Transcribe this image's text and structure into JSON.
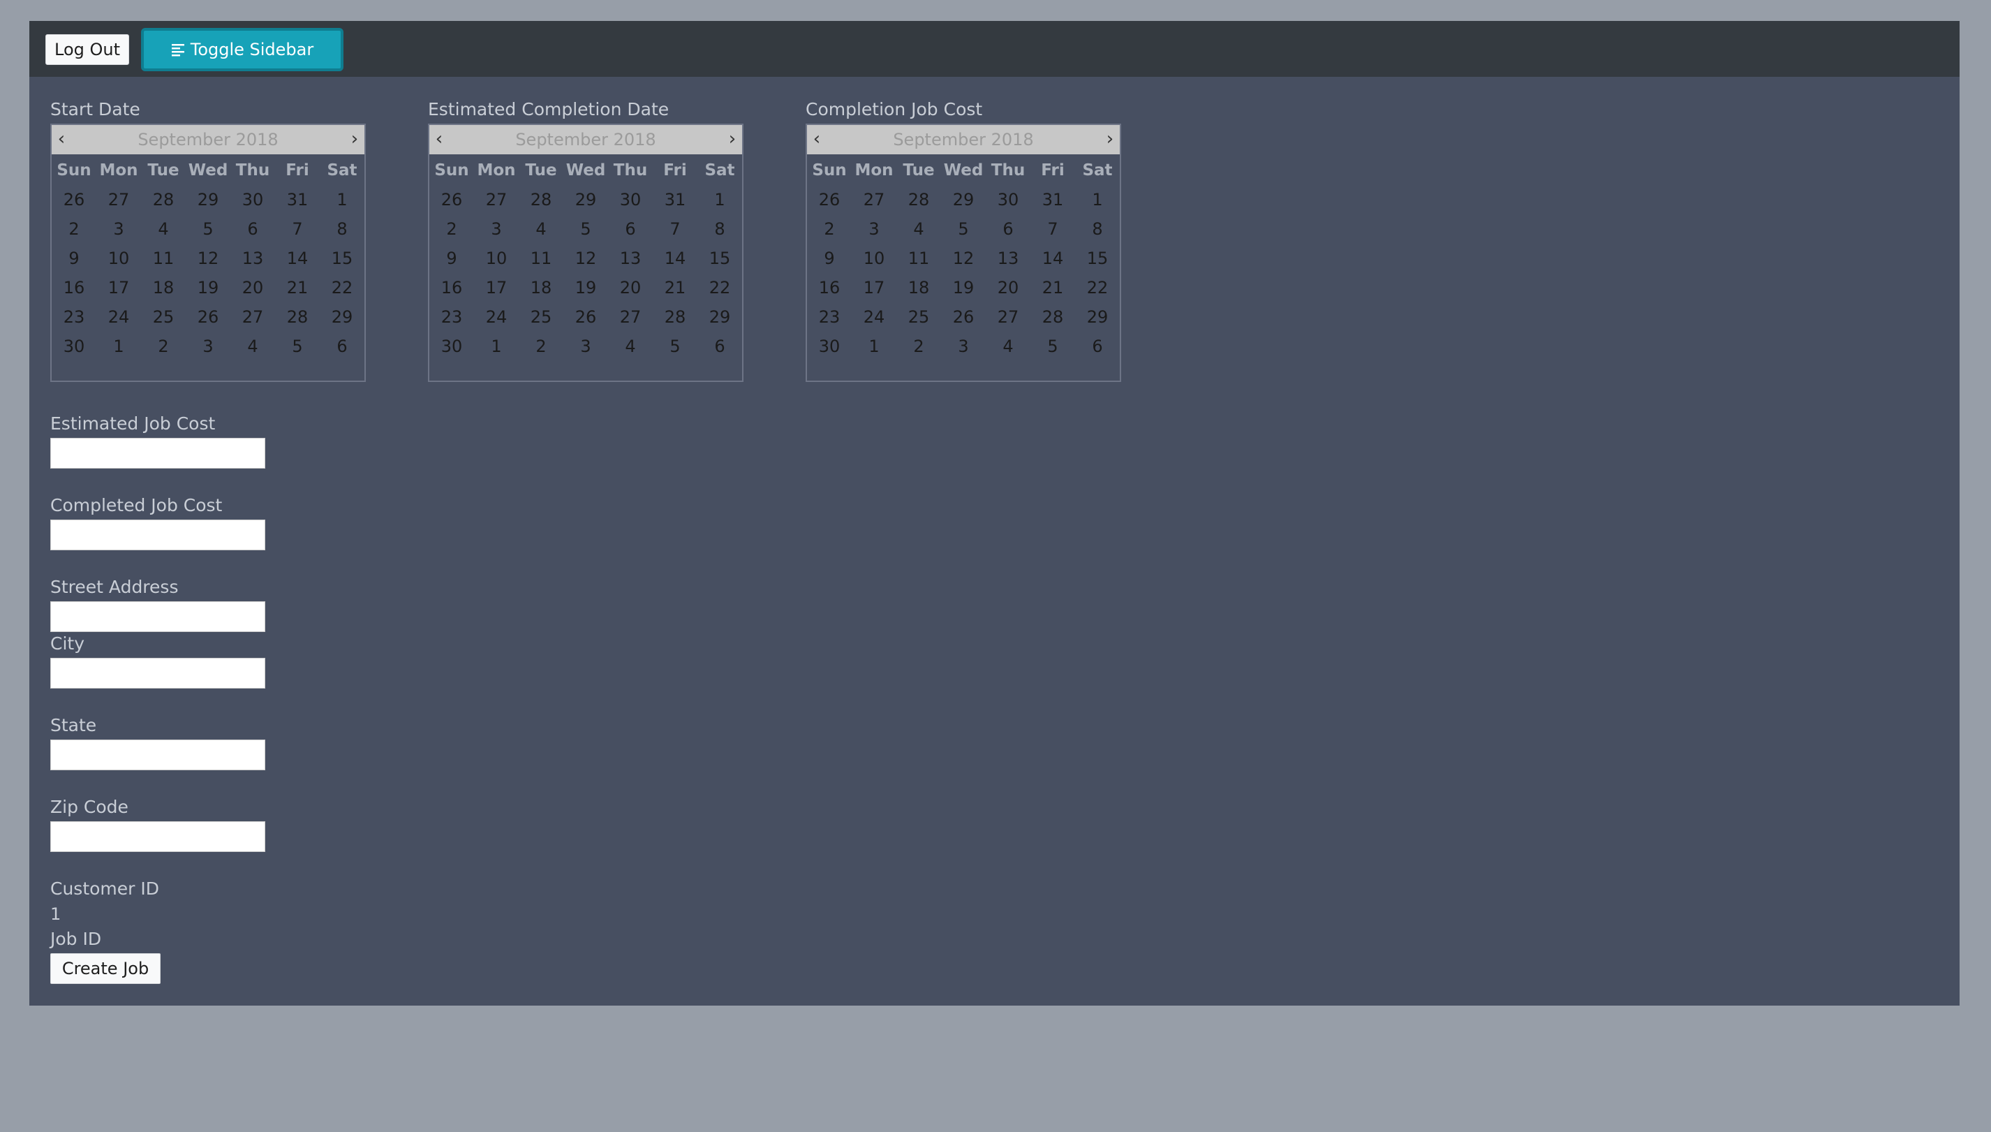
{
  "toolbar": {
    "logout_label": "Log Out",
    "toggle_label": "Toggle Sidebar"
  },
  "calendar_weekdays": [
    "Sun",
    "Mon",
    "Tue",
    "Wed",
    "Thu",
    "Fri",
    "Sat"
  ],
  "calendar_weeks": [
    [
      "26",
      "27",
      "28",
      "29",
      "30",
      "31",
      "1"
    ],
    [
      "2",
      "3",
      "4",
      "5",
      "6",
      "7",
      "8"
    ],
    [
      "9",
      "10",
      "11",
      "12",
      "13",
      "14",
      "15"
    ],
    [
      "16",
      "17",
      "18",
      "19",
      "20",
      "21",
      "22"
    ],
    [
      "23",
      "24",
      "25",
      "26",
      "27",
      "28",
      "29"
    ],
    [
      "30",
      "1",
      "2",
      "3",
      "4",
      "5",
      "6"
    ]
  ],
  "calendars": [
    {
      "label": "Start Date",
      "month": "September 2018",
      "prev": "‹",
      "next": "›"
    },
    {
      "label": "Estimated Completion Date",
      "month": "September 2018",
      "prev": "‹",
      "next": "›"
    },
    {
      "label": "Completion Job Cost",
      "month": "September 2018",
      "prev": "‹",
      "next": "›"
    }
  ],
  "form": {
    "estimated_job_cost": {
      "label": "Estimated Job Cost",
      "value": ""
    },
    "completed_job_cost": {
      "label": "Completed Job Cost",
      "value": ""
    },
    "street_address": {
      "label": "Street Address",
      "value": ""
    },
    "city": {
      "label": "City",
      "value": ""
    },
    "state": {
      "label": "State",
      "value": ""
    },
    "zip_code": {
      "label": "Zip Code",
      "value": ""
    },
    "customer_id": {
      "label": "Customer ID",
      "value": "1"
    },
    "job_id": {
      "label": "Job ID"
    },
    "create_button": "Create Job"
  },
  "colors": {
    "page_background": "#979ea8",
    "panel_background": "#474f61",
    "topbar_background": "#343a40",
    "accent": "#17a2b8"
  },
  "icons": {
    "toggle": "align-left-icon"
  }
}
